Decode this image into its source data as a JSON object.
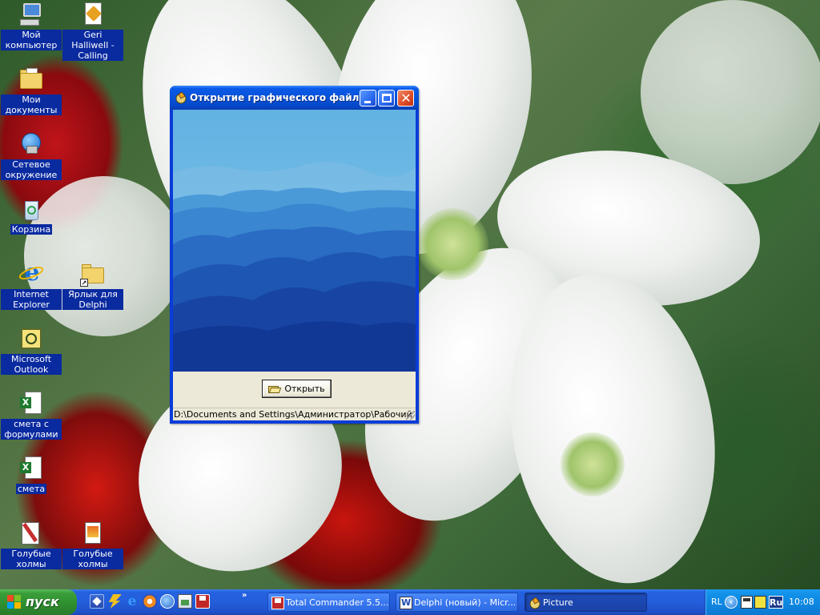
{
  "desktop": {
    "icons": [
      {
        "label": "Мой компьютер",
        "icon": "my-computer-icon"
      },
      {
        "label": "Geri Halliwell - Calling",
        "icon": "media-file-icon"
      },
      {
        "label": "Мои документы",
        "icon": "my-documents-icon"
      },
      {
        "label": "Сетевое окружение",
        "icon": "network-icon"
      },
      {
        "label": "Корзина",
        "icon": "recycle-bin-icon"
      },
      {
        "label": "Internet Explorer",
        "icon": "internet-explorer-icon"
      },
      {
        "label": "Ярлык для Delphi",
        "icon": "folder-shortcut-icon"
      },
      {
        "label": "Microsoft Outlook",
        "icon": "outlook-icon"
      },
      {
        "label": "смета с формулами",
        "icon": "excel-file-icon"
      },
      {
        "label": "смета",
        "icon": "excel-file-icon"
      },
      {
        "label": "Голубые холмы",
        "icon": "image-file-icon"
      },
      {
        "label": "Голубые холмы",
        "icon": "image-file-icon"
      }
    ]
  },
  "window": {
    "title": "Открытие графического файла",
    "open_button": "Открыть",
    "status_path": "D:\\Documents and Settings\\Администратор\\Рабочий стол"
  },
  "taskbar": {
    "start_label": "пуск",
    "tasks": [
      {
        "label": "Total Commander 5.5...",
        "icon": "total-commander-icon",
        "active": false
      },
      {
        "label": "Delphi (новый) - Micr...",
        "icon": "word-icon",
        "active": false
      },
      {
        "label": "Picture",
        "icon": "delphi-app-icon",
        "active": true
      }
    ],
    "tray": {
      "language": "RL",
      "keyboard": "Ru",
      "clock": "10:08"
    }
  },
  "colors": {
    "taskbar": "#245edb",
    "start": "#3a9e3a",
    "title_bar": "#0752d8",
    "window_face": "#ece9d8"
  }
}
